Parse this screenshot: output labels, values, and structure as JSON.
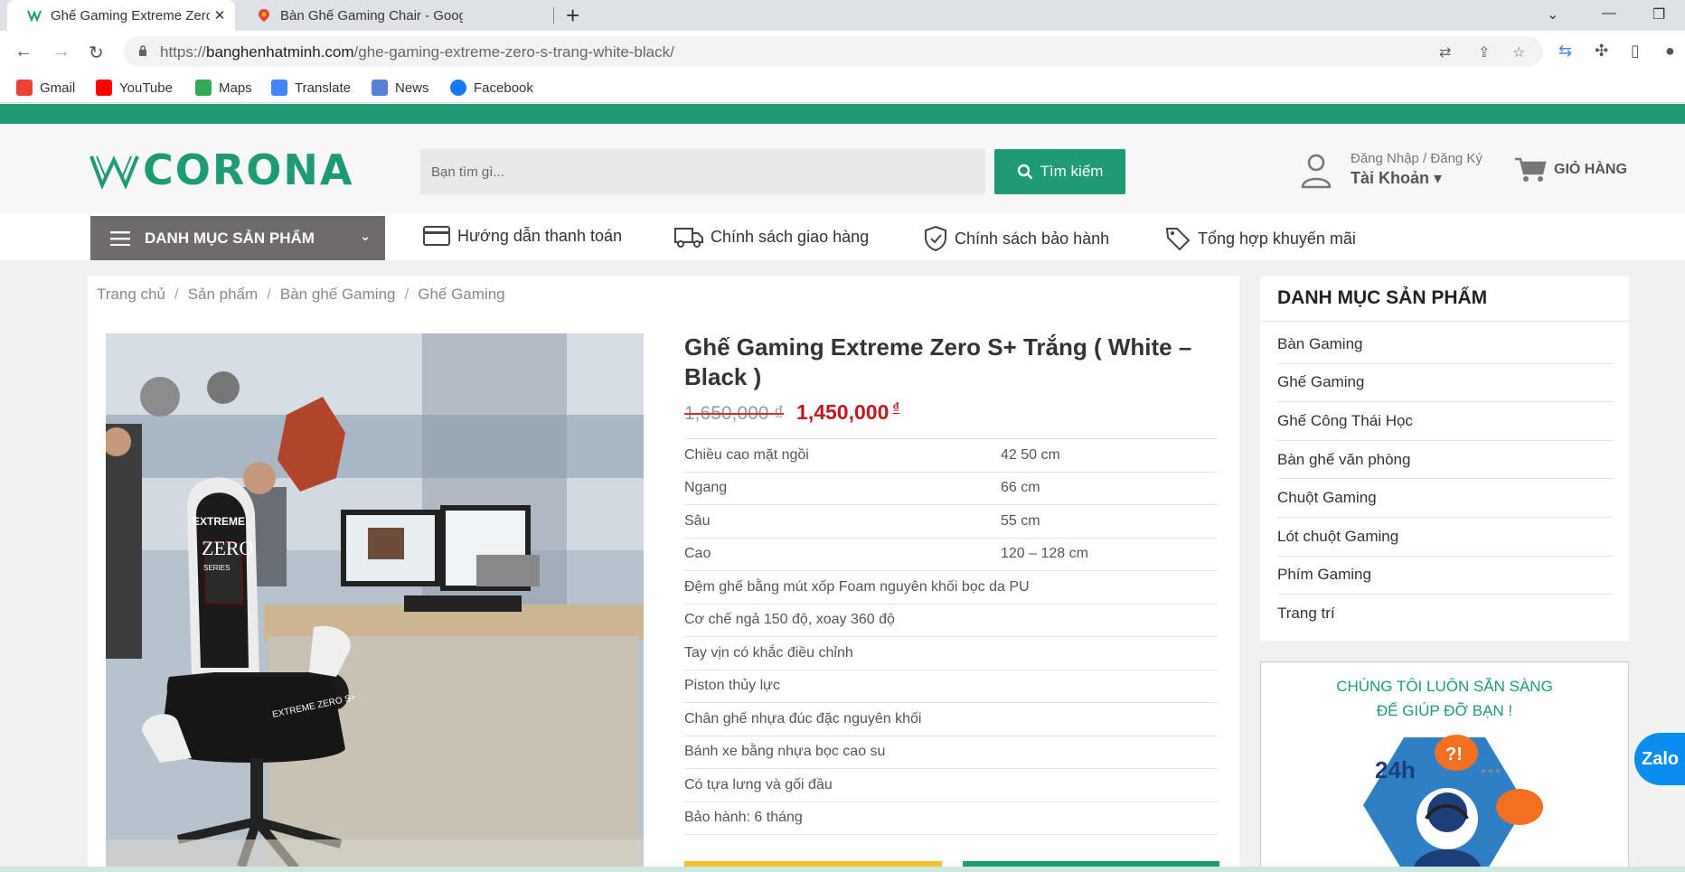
{
  "browser": {
    "tabs": [
      {
        "title": "Ghế Gaming Extreme Zero S+ Trắ",
        "active": true
      },
      {
        "title": "Bàn Ghế Gaming Chair - Google"
      }
    ],
    "url_domain": "banghenhatminh.com",
    "url_path": "/ghe-gaming-extreme-zero-s-trang-white-black/",
    "url_scheme": "https://",
    "bookmarks": [
      {
        "label": "Gmail",
        "color": "#ea4335"
      },
      {
        "label": "YouTube",
        "color": "#ff0000"
      },
      {
        "label": "Maps",
        "color": "#34a853"
      },
      {
        "label": "Translate",
        "color": "#4285f4"
      },
      {
        "label": "News",
        "color": "#5a7fd8"
      },
      {
        "label": "Facebook",
        "color": "#1877f2"
      }
    ]
  },
  "site": {
    "brand": "CORONA",
    "accent": "#1e9a74",
    "search_placeholder": "Bạn tìm gì...",
    "search_button": "Tìm kiếm",
    "account_line1": "Đăng Nhập / Đăng Ký",
    "account_line2": "Tài Khoản ▾",
    "cart_label": "GIỎ HÀNG",
    "category_button": "DANH MỤC SẢN PHẨM",
    "nav": [
      "Hướng dẫn thanh toán",
      "Chính sách giao hàng",
      "Chính sách bảo hành",
      "Tổng hợp khuyến mãi"
    ]
  },
  "breadcrumb": [
    "Trang chủ",
    "Sản phẩm",
    "Bàn ghế Gaming",
    "Ghế Gaming"
  ],
  "product": {
    "title": "Ghế Gaming Extreme Zero S+ Trắng ( White – Black )",
    "old_price": "1,650,000 ₫",
    "new_price": "1,450,000",
    "currency": "₫",
    "specs": [
      {
        "k": "Chiều cao mặt ngồi",
        "v": "42    50 cm"
      },
      {
        "k": "Ngang",
        "v": "66 cm"
      },
      {
        "k": "Sâu",
        "v": "55 cm"
      },
      {
        "k": "Cao",
        "v": "120 – 128 cm"
      },
      {
        "k": "Đệm ghế bằng mút xốp Foam nguyên khối bọc da PU",
        "v": ""
      },
      {
        "k": "Cơ chế ngả 150 độ, xoay 360 độ",
        "v": ""
      },
      {
        "k": "Tay vịn có khắc điều chỉnh",
        "v": ""
      },
      {
        "k": "Piston thủy lực",
        "v": ""
      },
      {
        "k": "Chân ghế nhựa đúc đặc nguyên khối",
        "v": ""
      },
      {
        "k": "Bánh xe bằng nhựa bọc cao su",
        "v": ""
      },
      {
        "k": "Có tựa lưng và gối đầu",
        "v": ""
      },
      {
        "k": "Bảo hành: 6 tháng",
        "v": ""
      }
    ]
  },
  "sidebar": {
    "heading": "DANH MỤC SẢN PHẨM",
    "items": [
      "Bàn Gaming",
      "Ghế Gaming",
      "Ghế Công Thái Học",
      "Bàn ghế văn phòng",
      "Chuột Gaming",
      "Lót chuột Gaming",
      "Phím Gaming",
      "Trang trí"
    ]
  },
  "help": {
    "line1": "CHÚNG TÔI LUÔN SẴN SÀNG",
    "line2": "ĐỂ GIÚP ĐỠ BẠN !",
    "badge": "24h",
    "bubble": "?!"
  },
  "zalo_label": "Zalo",
  "image_text": {
    "chair_brand": "EXTREME",
    "chair_logo": "ZERO",
    "chair_series": "SERIES",
    "chair_model": "EXTREME ZERO S+"
  }
}
